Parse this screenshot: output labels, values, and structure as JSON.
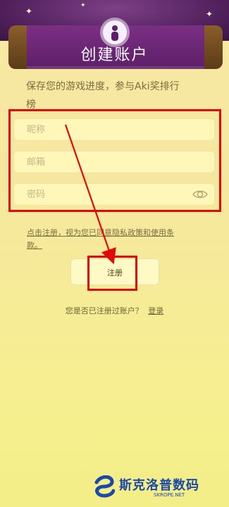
{
  "header": {
    "title": "创建账户"
  },
  "intro": {
    "text_line1": "保存您的游戏进度，参与Aki奖排行",
    "text_line2": "榜"
  },
  "form": {
    "nickname_placeholder": "昵称",
    "email_placeholder": "邮箱",
    "password_placeholder": "密码",
    "password_icon": "eye-icon"
  },
  "policy": {
    "text_line1": "点击注册，视为您已同意隐私政策和使用条",
    "text_line2": "款。"
  },
  "actions": {
    "register_label": "注册",
    "login_prompt": "您是否已注册过账户？",
    "login_link": "登录"
  },
  "watermark": {
    "brand_text": "斯克洛普数码",
    "brand_url": "SKROPE.NET"
  },
  "colors": {
    "highlight": "#e10a0a",
    "banner": "#5d1f68",
    "background": "#f6e7a0"
  }
}
